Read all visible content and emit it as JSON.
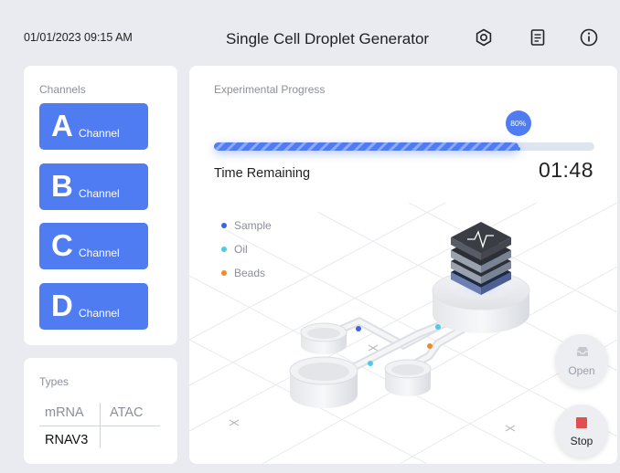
{
  "header": {
    "datetime": "01/01/2023 09:15 AM",
    "title": "Single Cell Droplet Generator",
    "icons": [
      "settings-icon",
      "log-icon",
      "info-icon"
    ]
  },
  "channels": {
    "label": "Channels",
    "items": [
      {
        "letter": "A",
        "word": "Channel"
      },
      {
        "letter": "B",
        "word": "Channel"
      },
      {
        "letter": "C",
        "word": "Channel"
      },
      {
        "letter": "D",
        "word": "Channel"
      }
    ]
  },
  "types": {
    "label": "Types",
    "options": [
      "mRNA",
      "ATAC"
    ],
    "selected": "RNAV3"
  },
  "progress": {
    "label": "Experimental Progress",
    "percent": 80,
    "percent_text": "80%",
    "time_label": "Time Remaining",
    "time_value": "01:48"
  },
  "legend": [
    {
      "label": "Sample",
      "color": "#3b63e6"
    },
    {
      "label": "Oil",
      "color": "#4ec9e8"
    },
    {
      "label": "Beads",
      "color": "#f08a2c"
    }
  ],
  "actions": {
    "open_label": "Open",
    "stop_label": "Stop"
  },
  "colors": {
    "accent": "#4f7cf0",
    "stop": "#e05050",
    "panel": "#ffffff",
    "background": "#e9ebf0"
  }
}
